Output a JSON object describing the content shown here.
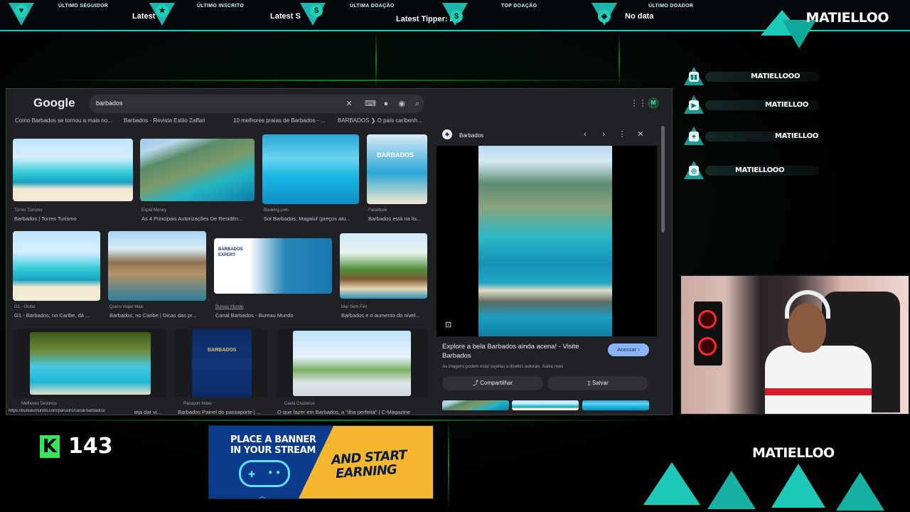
{
  "topbar": {
    "items": [
      {
        "label": "ÚLTIMO SEGUIDOR",
        "value": "Latest",
        "icon": "heart-icon",
        "glyph": "♥"
      },
      {
        "label": "ÚLTIMO INSCRITO",
        "value": "Latest S",
        "icon": "star-icon",
        "glyph": "★"
      },
      {
        "label": "ÚLTIMA DOAÇÃO",
        "value": "Latest Tipper: ra",
        "icon": "dollar-icon",
        "glyph": "$"
      },
      {
        "label": "TOP DOAÇÃO",
        "value": "",
        "icon": "money-bag-icon",
        "glyph": "$"
      },
      {
        "label": "ÚLTIMO DOADOR",
        "value": "No data",
        "icon": "diamond-icon",
        "glyph": "◆"
      }
    ],
    "brand": "MATIELLOO",
    "accent": "#1fc9b9"
  },
  "browser": {
    "logo": "Google",
    "search_query": "barbados",
    "chips": [
      "Como Barbados se tornou a mais no...",
      "Barbados - Revista Estilo Zaffari",
      "10 melhores praias de Barbados - ...",
      "BARBADOS ❯ O país caribenh..."
    ],
    "results": [
      {
        "source": "Torres Turismo",
        "caption": "Barbados | Torres Turismo"
      },
      {
        "source": "Expat Money",
        "caption": "As 4 Principais Autorizações De Residên..."
      },
      {
        "source": "Booking.com",
        "caption": "Sol Barbados, Magaluf (preços atu..."
      },
      {
        "source": "Facebook",
        "caption": "Barbados está na lis...",
        "overlay": "BARBADOS"
      },
      {
        "source": "G1 - Globo",
        "caption": "G1 - Barbados, no Caribe, dá ..."
      },
      {
        "source": "Quero Viajar Mais",
        "caption": "Barbados, no Caribe | Dicas das pr..."
      },
      {
        "source": "Bureau Mundo",
        "caption": "Canal Barbados - Bureau Mundo",
        "overlay": "BARBADOS EXPERT"
      },
      {
        "source": "Mar Sem Fim",
        "caption": "Barbados e o aumento do nível..."
      },
      {
        "source": "Melhores Destinos",
        "caption": "planeja dar vi..."
      },
      {
        "source": "Passport Index",
        "caption": "Barbados Painel do passaporte | ...",
        "overlay": "BARBADOS"
      },
      {
        "source": "Cavia Cruzeiros",
        "caption": "O que fazer em Barbados, a \"ilha perfeita\" | C-Magazine"
      }
    ],
    "status_url": "https://bureaumundo.com/parceiro/canal-barbados/",
    "preview": {
      "site": "Barbados",
      "title": "Explore a bela Barbados ainda acena! - Visite Barbados",
      "visit_label": "Acessar ›",
      "rights": "As imagens podem estar sujeitas a direitos autorais.  Saiba mais",
      "share_label": "Compartilhar",
      "save_label": "Salvar"
    }
  },
  "social": [
    {
      "platform": "twitch",
      "icon": "twitch-icon",
      "glyph": "▮▮",
      "name": "MATIELLOOO"
    },
    {
      "platform": "youtube",
      "icon": "youtube-icon",
      "glyph": "▶",
      "name": "MATIELLOO"
    },
    {
      "platform": "twitter",
      "icon": "twitter-icon",
      "glyph": "✦",
      "name": "MATIELLOO"
    },
    {
      "platform": "instagram",
      "icon": "instagram-icon",
      "glyph": "◎",
      "name": "MATIELLOOO"
    }
  ],
  "kick": {
    "logo": "K",
    "count": "143",
    "color": "#39e35a"
  },
  "banner": {
    "line1": "PLACE A BANNER",
    "line2": "IN YOUR STREAM",
    "right1": "AND START",
    "right2": "EARNING"
  },
  "brand_bottom": "MATIELLOO"
}
